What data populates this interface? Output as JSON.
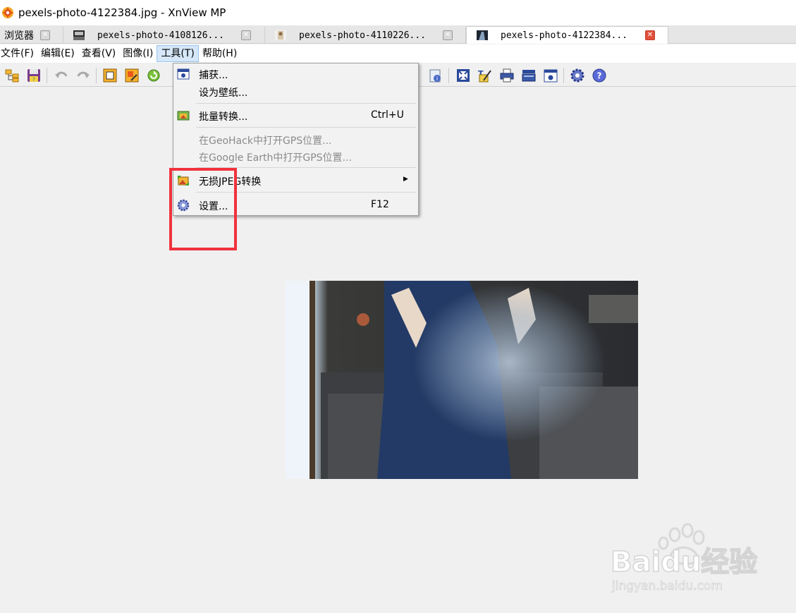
{
  "window": {
    "title": "pexels-photo-4122384.jpg - XnView MP"
  },
  "tabs": [
    {
      "label": "浏览器",
      "active": false
    },
    {
      "label": "pexels-photo-4108126...",
      "active": false
    },
    {
      "label": "pexels-photo-4110226...",
      "active": false
    },
    {
      "label": "pexels-photo-4122384...",
      "active": true
    }
  ],
  "menubar": {
    "items": [
      "文件(F)",
      "编辑(E)",
      "查看(V)",
      "图像(I)",
      "工具(T)",
      "帮助(H)"
    ],
    "open_item": "工具(T)"
  },
  "toolbar": {
    "icons": [
      "folder-tree-icon",
      "save-icon",
      "undo-icon",
      "redo-icon",
      "crop-icon",
      "resize-icon",
      "rotate-icon",
      "info-icon",
      "fit-window-icon",
      "edit-icon",
      "print-icon",
      "scanner-icon",
      "capture-icon",
      "settings-icon",
      "help-icon"
    ]
  },
  "tools_menu": {
    "items": [
      {
        "label": "捕获...",
        "shortcut": "",
        "icon": "capture-icon",
        "disabled": false
      },
      {
        "label": "设为壁纸...",
        "shortcut": "",
        "icon": "",
        "disabled": false
      },
      {
        "label": "批量转换...",
        "shortcut": "Ctrl+U",
        "icon": "batch-convert-icon",
        "disabled": false
      },
      {
        "label": "在GeoHack中打开GPS位置...",
        "shortcut": "",
        "icon": "",
        "disabled": true
      },
      {
        "label": "在Google Earth中打开GPS位置...",
        "shortcut": "",
        "icon": "",
        "disabled": true
      },
      {
        "label": "无损JPEG转换",
        "shortcut": "",
        "icon": "lossless-jpeg-icon",
        "disabled": false,
        "has_submenu": true
      },
      {
        "label": "设置...",
        "shortcut": "F12",
        "icon": "gear-icon",
        "disabled": false
      }
    ]
  },
  "watermark": {
    "brand": "Baidu经验",
    "url": "jingyan.baidu.com"
  },
  "colors": {
    "menu_highlight": "#d5e7f8",
    "annotation_red": "#f0323c",
    "tab_close_active": "#e0503c"
  }
}
